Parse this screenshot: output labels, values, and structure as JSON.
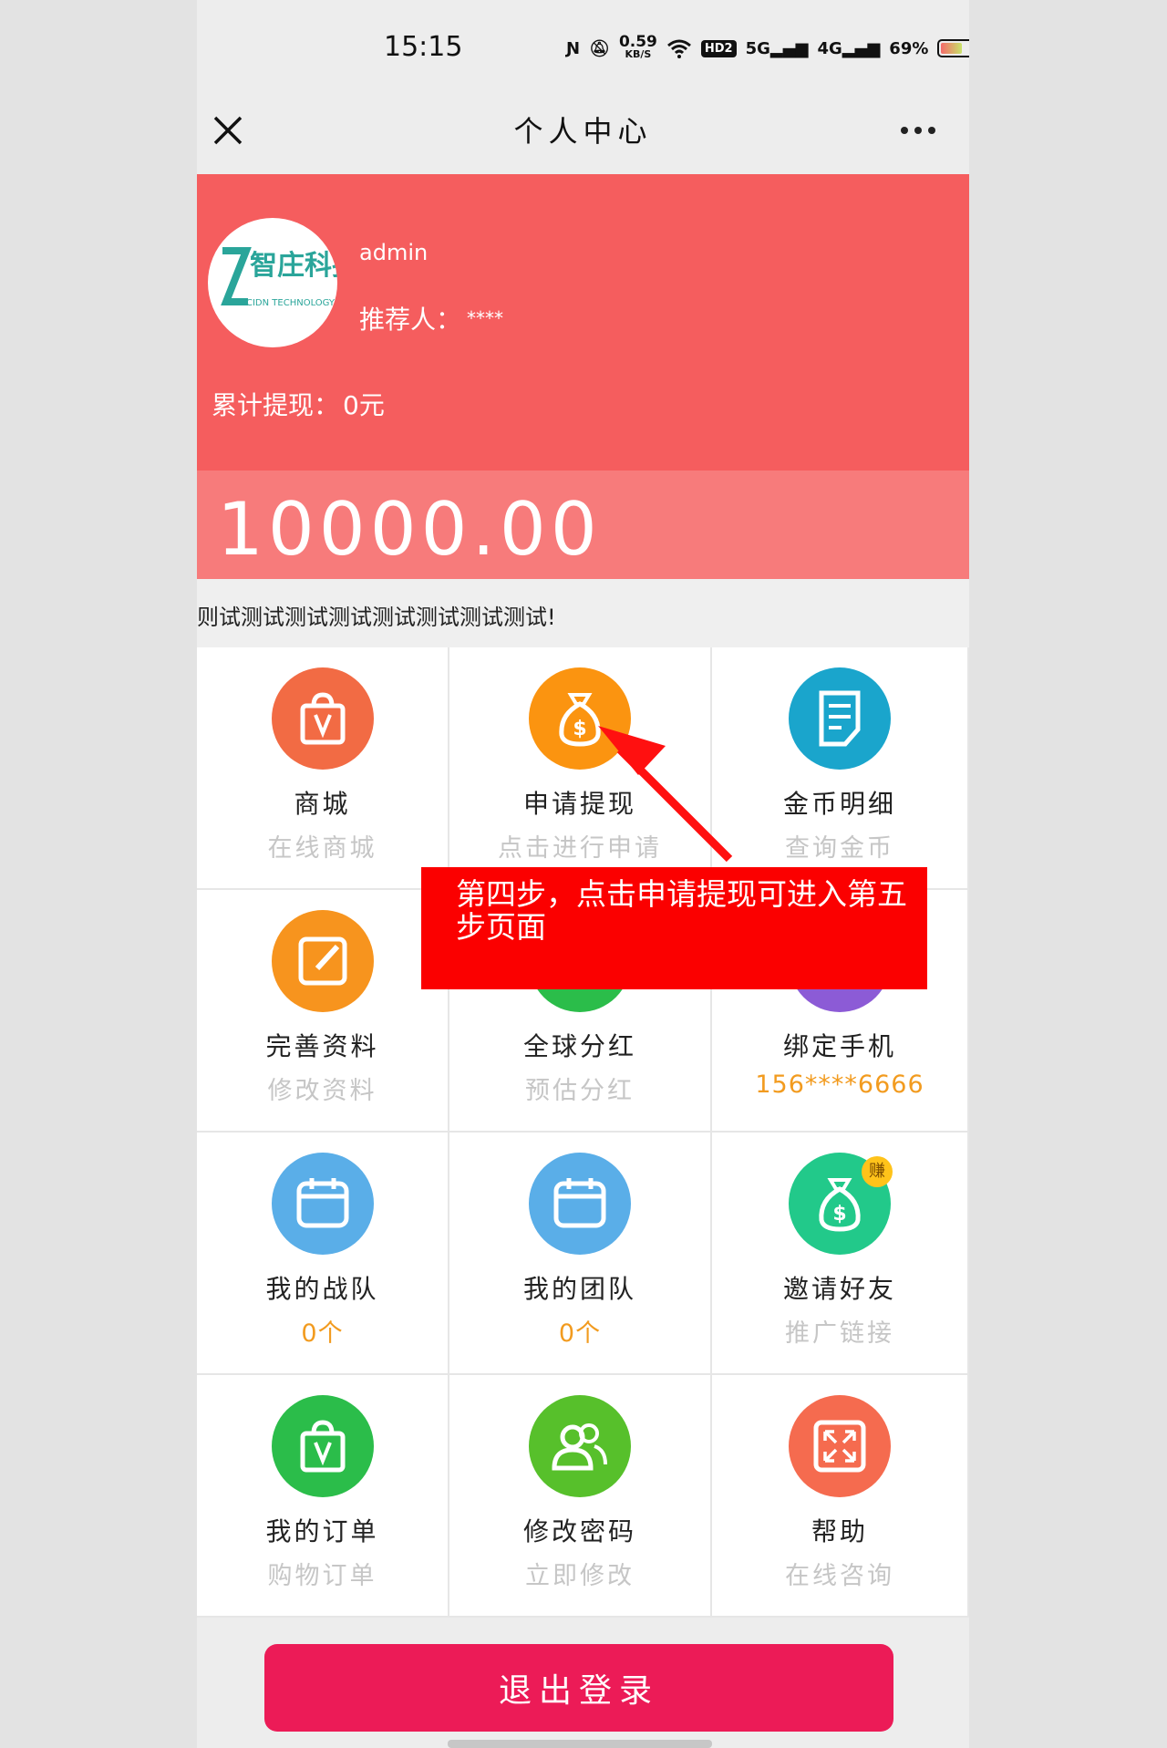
{
  "status_bar": {
    "time": "15:15",
    "net_speed_value": "0.59",
    "net_speed_unit": "KB/S",
    "hd_label": "HD2",
    "signal_5g": "5G",
    "signal_4g": "4G",
    "battery_percent": "69%",
    "battery_level": 0.69
  },
  "header": {
    "title": "个人中心"
  },
  "profile": {
    "avatar_brand_cn": "智庄科技",
    "avatar_brand_en": "CIDN TECHNOLOGY",
    "username": "admin",
    "referrer_label": "推荐人：",
    "referrer_value": "****",
    "total_withdraw_label": "累计提现：",
    "total_withdraw_value": "0元",
    "balance": "10000.00"
  },
  "marquee": {
    "text": "则试测试测试测试测试测试测试测试!"
  },
  "grid": [
    {
      "title": "商城",
      "sub": "在线商城",
      "color": "#f26b44",
      "icon": "shopping-bag-icon"
    },
    {
      "title": "申请提现",
      "sub": "点击进行申请",
      "color": "#fb9410",
      "icon": "money-bag-icon"
    },
    {
      "title": "金币明细",
      "sub": "查询金币",
      "color": "#1aa5cc",
      "icon": "document-icon"
    },
    {
      "title": "完善资料",
      "sub": "修改资料",
      "color": "#f7941e",
      "icon": "edit-icon"
    },
    {
      "title": "全球分红",
      "sub": "预估分红",
      "color": "#2bbd4a",
      "icon": "globe-icon"
    },
    {
      "title": "绑定手机",
      "sub": "156****6666",
      "color": "#8c5bd6",
      "icon": "phone-icon"
    },
    {
      "title": "我的战队",
      "sub": "0个",
      "color": "#5aaee8",
      "icon": "calendar-icon"
    },
    {
      "title": "我的团队",
      "sub": "0个",
      "color": "#5aaee8",
      "icon": "calendar-icon"
    },
    {
      "title": "邀请好友",
      "sub": "推广链接",
      "color": "#22c98a",
      "icon": "money-bag-icon",
      "badge": "赚"
    },
    {
      "title": "我的订单",
      "sub": "购物订单",
      "color": "#2bbd4a",
      "icon": "shopping-bag-icon"
    },
    {
      "title": "修改密码",
      "sub": "立即修改",
      "color": "#57c02b",
      "icon": "users-icon"
    },
    {
      "title": "帮助",
      "sub": "在线咨询",
      "color": "#f56b4f",
      "icon": "expand-icon"
    }
  ],
  "logout": {
    "label": "退出登录"
  },
  "annotation": {
    "text": "第四步，点击申请提现可进入第五步页面"
  }
}
